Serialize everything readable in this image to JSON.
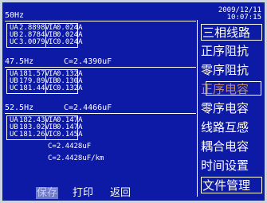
{
  "clock": {
    "date": "2009/12/11",
    "time": "10:07:15"
  },
  "block1": {
    "freq": "50Hz",
    "rows": [
      {
        "vlabel": "UA",
        "vval": "2.8898V",
        "ilabel": "IA",
        "ival": "0.024A"
      },
      {
        "vlabel": "UB",
        "vval": "2.8784V",
        "ilabel": "IB",
        "ival": "0.024A"
      },
      {
        "vlabel": "UC",
        "vval": "3.0079V",
        "ilabel": "IC",
        "ival": "0.024A"
      }
    ]
  },
  "block2": {
    "freq": "47.5Hz",
    "cap": "C=2.4390uF",
    "rows": [
      {
        "vlabel": "UA",
        "vval": "181.57V",
        "ilabel": "IA",
        "ival": "0.132A"
      },
      {
        "vlabel": "UB",
        "vval": "179.89V",
        "ilabel": "IB",
        "ival": "0.130A"
      },
      {
        "vlabel": "UC",
        "vval": "181.44V",
        "ilabel": "IC",
        "ival": "0.132A"
      }
    ]
  },
  "block3": {
    "freq": "52.5Hz",
    "cap": "C=2.4466uF",
    "rows": [
      {
        "vlabel": "UA",
        "vval": "182.43V",
        "ilabel": "IA",
        "ival": "0.147A"
      },
      {
        "vlabel": "UB",
        "vval": "183.02V",
        "ilabel": "IB",
        "ival": "0.147A"
      },
      {
        "vlabel": "UC",
        "vval": "181.26V",
        "ilabel": "IC",
        "ival": "0.145A"
      }
    ]
  },
  "result": {
    "c_total": "C=2.4428uF",
    "c_per_km": "C=2.4428uF/km"
  },
  "menu": {
    "items": [
      "三相线路",
      "正序阻抗",
      "零序阻抗",
      "正序电容",
      "零序电容",
      "线路互感",
      "耦合电容",
      "时间设置",
      "文件管理"
    ],
    "selected_index": 3
  },
  "bottom": {
    "save": "保存",
    "print": "打印",
    "back": "返回",
    "active": "save"
  },
  "colors": {
    "screen_bg": "#0d1aa6",
    "text": "#ffffff",
    "frame": "#c9d3e4",
    "selected_text": "#c08a7a",
    "button_highlight": "#6d79c9"
  }
}
